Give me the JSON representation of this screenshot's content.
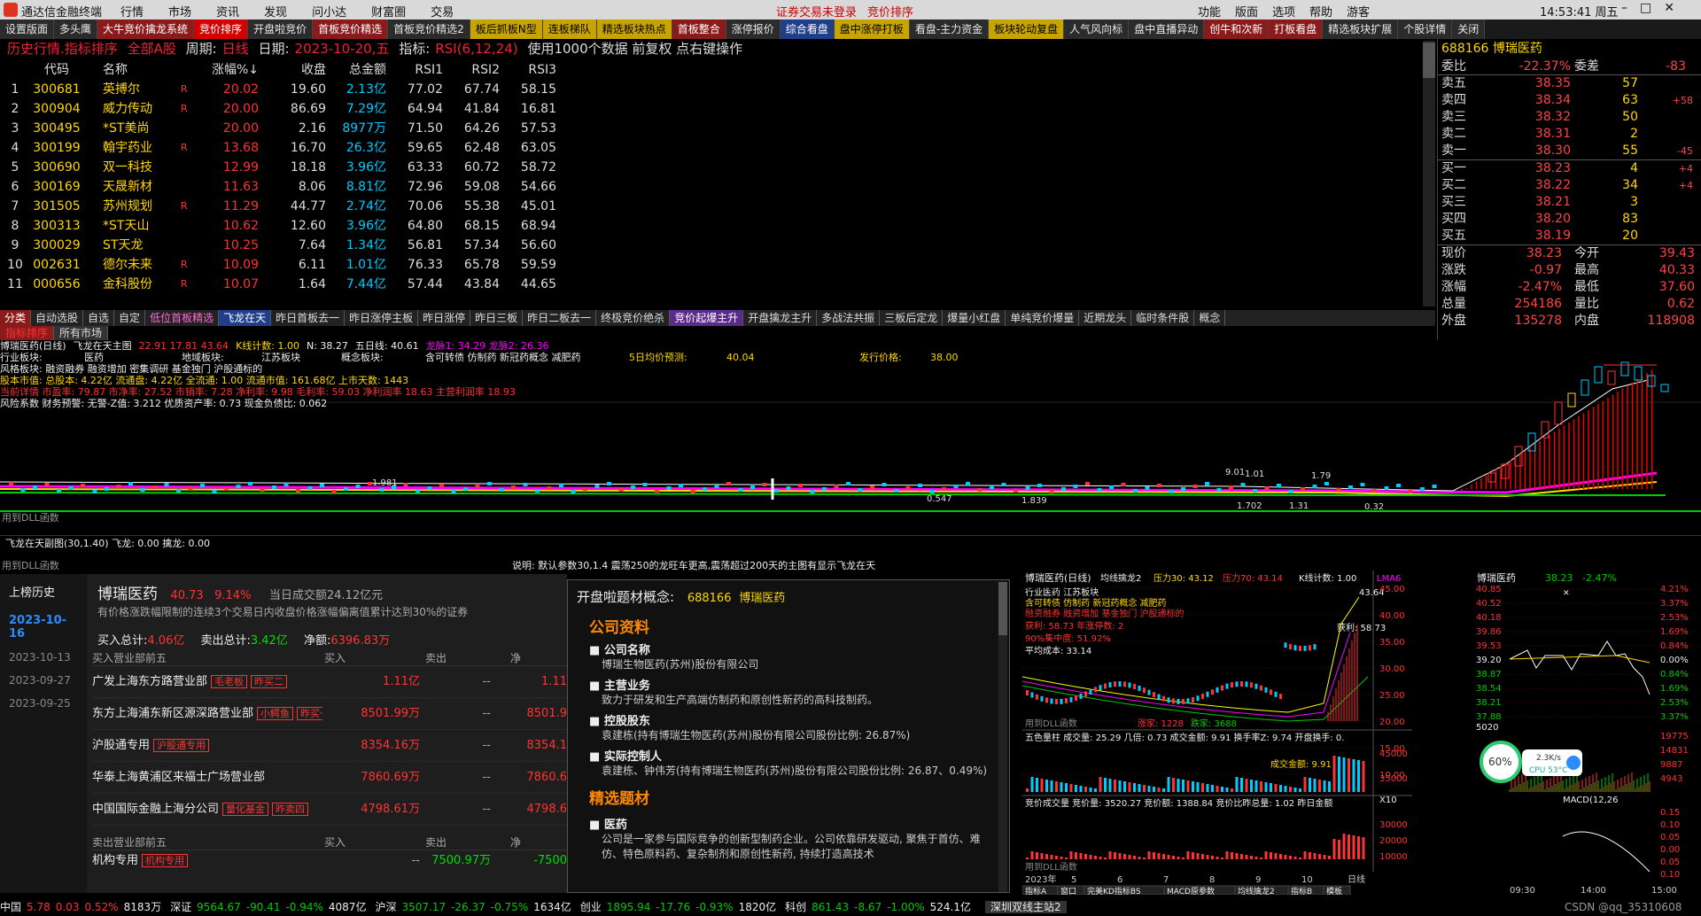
{
  "titlebar": {
    "app": "通达信金融终端",
    "menus": [
      "行情",
      "市场",
      "资讯",
      "发现",
      "问小达",
      "财富圈",
      "交易"
    ],
    "status": "证券交易未登录",
    "page": "竞价排序",
    "right": [
      "功能",
      "版面",
      "选项",
      "帮助",
      "游客"
    ],
    "time": "14:53:41 周五"
  },
  "tabs": [
    {
      "label": "设置版面",
      "cls": ""
    },
    {
      "label": "多头鹰",
      "cls": ""
    },
    {
      "label": "大牛竞价擒龙系统",
      "cls": "red"
    },
    {
      "label": "竞价排序",
      "cls": "act"
    },
    {
      "label": "开盘啦竞价",
      "cls": ""
    },
    {
      "label": "首板竞价精选",
      "cls": "red"
    },
    {
      "label": "首板竞价精选2",
      "cls": ""
    },
    {
      "label": "板后抓板N型",
      "cls": "yel"
    },
    {
      "label": "连板梯队",
      "cls": "yel"
    },
    {
      "label": "精选板块热点",
      "cls": "yel"
    },
    {
      "label": "首板整合",
      "cls": "red"
    },
    {
      "label": "涨停报价",
      "cls": ""
    },
    {
      "label": "综合看盘",
      "cls": "blu"
    },
    {
      "label": "盘中涨停打板",
      "cls": "yel"
    },
    {
      "label": "看盘-主力资金",
      "cls": ""
    },
    {
      "label": "板块轮动复盘",
      "cls": "yel"
    },
    {
      "label": "人气风向标",
      "cls": ""
    },
    {
      "label": "盘中直播异动",
      "cls": ""
    },
    {
      "label": "创牛和次新",
      "cls": "red"
    },
    {
      "label": "打板看盘",
      "cls": "red"
    },
    {
      "label": "精选板块扩展",
      "cls": ""
    },
    {
      "label": "个股详情",
      "cls": ""
    },
    {
      "label": "关闭",
      "cls": ""
    }
  ],
  "header": {
    "title": "历史行情.指标排序",
    "market": "全部A股",
    "period_label": "周期:",
    "period": "日线",
    "date_label": "日期:",
    "date": "2023-10-20,五",
    "indicator_label": "指标:",
    "indicator": "RSI(6,12,24)",
    "note": "使用1000个数据 前复权 点右键操作"
  },
  "table": {
    "headers": [
      "",
      "代码",
      "名称",
      "涨幅%↓",
      "收盘",
      "总金额",
      "RSI1",
      "RSI2",
      "RSI3"
    ],
    "rows": [
      {
        "n": "1",
        "code": "300681",
        "name": "英搏尔",
        "flag": "R",
        "chg": "20.02",
        "close": "19.60",
        "amt": "2.13亿",
        "r1": "77.02",
        "r2": "67.74",
        "r3": "58.15"
      },
      {
        "n": "2",
        "code": "300904",
        "name": "威力传动",
        "flag": "R",
        "chg": "20.00",
        "close": "86.69",
        "amt": "7.29亿",
        "r1": "64.94",
        "r2": "41.84",
        "r3": "16.81"
      },
      {
        "n": "3",
        "code": "300495",
        "name": "*ST美尚",
        "flag": "",
        "chg": "20.00",
        "close": "2.16",
        "amt": "8977万",
        "r1": "71.50",
        "r2": "64.26",
        "r3": "57.53"
      },
      {
        "n": "4",
        "code": "300199",
        "name": "翰宇药业",
        "flag": "R",
        "chg": "13.68",
        "close": "16.70",
        "amt": "26.3亿",
        "r1": "59.65",
        "r2": "62.48",
        "r3": "63.05"
      },
      {
        "n": "5",
        "code": "300690",
        "name": "双一科技",
        "flag": "",
        "chg": "12.99",
        "close": "18.18",
        "amt": "3.96亿",
        "r1": "63.33",
        "r2": "60.72",
        "r3": "58.72"
      },
      {
        "n": "6",
        "code": "300169",
        "name": "天晟新材",
        "flag": "",
        "chg": "11.63",
        "close": "8.06",
        "amt": "8.81亿",
        "r1": "72.96",
        "r2": "59.08",
        "r3": "54.66"
      },
      {
        "n": "7",
        "code": "301505",
        "name": "苏州规划",
        "flag": "R",
        "chg": "11.29",
        "close": "44.77",
        "amt": "2.74亿",
        "r1": "70.06",
        "r2": "55.38",
        "r3": "45.01"
      },
      {
        "n": "8",
        "code": "300313",
        "name": "*ST天山",
        "flag": "",
        "chg": "10.62",
        "close": "12.60",
        "amt": "3.96亿",
        "r1": "64.80",
        "r2": "68.15",
        "r3": "68.94"
      },
      {
        "n": "9",
        "code": "300029",
        "name": "ST天龙",
        "flag": "",
        "chg": "10.25",
        "close": "7.64",
        "amt": "1.34亿",
        "r1": "56.81",
        "r2": "57.34",
        "r3": "56.60"
      },
      {
        "n": "10",
        "code": "002631",
        "name": "德尔未来",
        "flag": "R",
        "chg": "10.09",
        "close": "6.11",
        "amt": "1.01亿",
        "r1": "76.33",
        "r2": "65.78",
        "r3": "59.59"
      },
      {
        "n": "11",
        "code": "000656",
        "name": "金科股份",
        "flag": "R",
        "chg": "10.07",
        "close": "1.64",
        "amt": "7.44亿",
        "r1": "57.44",
        "r2": "43.84",
        "r3": "44.65"
      }
    ]
  },
  "quote": {
    "code": "688166",
    "name": "博瑞医药",
    "wb_label": "委比",
    "wb": "-22.37%",
    "wc_label": "委差",
    "wc": "-83",
    "asks": [
      {
        "l": "卖五",
        "p": "38.35",
        "v": "57",
        "d": ""
      },
      {
        "l": "卖四",
        "p": "38.34",
        "v": "63",
        "d": "+58"
      },
      {
        "l": "卖三",
        "p": "38.32",
        "v": "50",
        "d": ""
      },
      {
        "l": "卖二",
        "p": "38.31",
        "v": "2",
        "d": ""
      },
      {
        "l": "卖一",
        "p": "38.30",
        "v": "55",
        "d": "-45"
      }
    ],
    "bids": [
      {
        "l": "买一",
        "p": "38.23",
        "v": "4",
        "d": "+4"
      },
      {
        "l": "买二",
        "p": "38.22",
        "v": "34",
        "d": "+4"
      },
      {
        "l": "买三",
        "p": "38.21",
        "v": "3",
        "d": ""
      },
      {
        "l": "买四",
        "p": "38.20",
        "v": "83",
        "d": ""
      },
      {
        "l": "买五",
        "p": "38.19",
        "v": "20",
        "d": ""
      }
    ],
    "stats": [
      {
        "l": "现价",
        "v": "38.23",
        "l2": "今开",
        "v2": "39.43"
      },
      {
        "l": "涨跌",
        "v": "-0.97",
        "l2": "最高",
        "v2": "40.33"
      },
      {
        "l": "涨幅",
        "v": "-2.47%",
        "l2": "最低",
        "v2": "37.60"
      },
      {
        "l": "总量",
        "v": "254186",
        "l2": "量比",
        "v2": "0.62"
      },
      {
        "l": "外盘",
        "v": "135278",
        "l2": "内盘",
        "v2": "118908"
      }
    ]
  },
  "tabs2": [
    "分类",
    "自动选股",
    "自选",
    "自定",
    "低位首板精选",
    "飞龙在天",
    "昨日首板去一",
    "昨日涨停主板",
    "昨日涨停",
    "昨日三板",
    "昨日二板去一",
    "终极竞价绝杀",
    "竞价起爆主升",
    "开盘擒龙主升",
    "多战法共振",
    "三板后定龙",
    "爆量小红盘",
    "单纯竞价爆量",
    "近期龙头",
    "临时条件股",
    "概念"
  ],
  "tabs3": [
    "指标排序",
    "所有市场"
  ],
  "chart": {
    "title": "博瑞医药(日线)",
    "ind": "飞龙在天主图",
    "vals": "22.91 17.81 43.64",
    "kcount": "K线计数: 1.00",
    "n": "N: 38.27",
    "wline": "五日线: 40.61",
    "dragon": "龙脉1: 34.29 龙脉2: 26.36",
    "l1": "行业板块:",
    "l1v": "医药",
    "l2": "地域板块:",
    "l2v": "江苏板块",
    "l3": "概念板块:",
    "l3v": "含可转债 仿制药 新冠药概念 减肥药",
    "l4": "风格板块:",
    "l4v": "融资融券 融资增加 密集调研 基金独门 沪股通标的",
    "fiveday": "5日均价预测:",
    "fiveday_v": "40.04",
    "fx": "发行价格:",
    "fx_v": "38.00",
    "cap": "股本市值: 总股本: 4.22亿 流通盘: 4.22亿 全流通: 1.00 流通市值: 161.68亿 上市天数: 1443",
    "fin": "当前详情 市盈率: 79.87 市净率: 27.52 市销率: 7.28 净利率: 9.98 毛利率: 59.03 净利润率 18.63 主营利润率 18.93",
    "risk": "风险系数 财务预警: 无警-Z值: 3.212 优质资产率: 0.73 现金负债比: 0.062",
    "dll": "用到DLL函数",
    "sub": "飞龙在天副图(30,1.40) 飞龙: 0.00 擒龙: 0.00",
    "note": "说明: 默认参数30,1.4 震荡250的龙旺车更高,震荡超过200天的主图有显示飞龙在天",
    "ann": [
      "1.981",
      "1.79",
      "1.01",
      "9.01",
      "0.547",
      "1.839",
      "1.702",
      "1.31",
      "0.32"
    ]
  },
  "lhb": {
    "side": [
      "上榜历史",
      "2023-10-16",
      "2023-10-13",
      "2023-09-27",
      "2023-09-25"
    ],
    "name": "博瑞医药",
    "price": "40.73",
    "pct": "9.14%",
    "amt": "当日成交额24.12亿元",
    "desc": "有价格涨跌幅限制的连续3个交易日内收盘价格涨幅偏离值累计达到30%的证券",
    "buy_total": "4.06亿",
    "sell_total": "3.42亿",
    "net": "6396.83万",
    "buy_label": "买入总计:",
    "sell_label": "卖出总计:",
    "net_label": "净额:",
    "col_h": [
      "买入营业部前五",
      "买入",
      "卖出",
      "净"
    ],
    "rows": [
      {
        "name": "广发上海东方路营业部",
        "tags": [
          "毛老板",
          "昨买二"
        ],
        "buy": "1.11亿",
        "sell": "--",
        "net": "1.11"
      },
      {
        "name": "东方上海浦东新区源深路营业部",
        "tags": [
          "小鳄鱼",
          "昨买一"
        ],
        "buy": "8501.99万",
        "sell": "--",
        "net": "8501.9"
      },
      {
        "name": "沪股通专用",
        "tags": [
          "沪股通专用"
        ],
        "buy": "8354.16万",
        "sell": "--",
        "net": "8354.1"
      },
      {
        "name": "华泰上海黄浦区来福士广场营业部",
        "tags": [],
        "buy": "7860.69万",
        "sell": "--",
        "net": "7860.6"
      },
      {
        "name": "中国国际金融上海分公司",
        "tags": [
          "量化基金",
          "昨卖四"
        ],
        "buy": "4798.61万",
        "sell": "--",
        "net": "4798.6"
      }
    ],
    "sell_h": [
      "卖出营业部前五",
      "买入",
      "卖出",
      "净"
    ],
    "sell_row": {
      "name": "机构专用",
      "tags": [
        "机构专用"
      ],
      "buy": "--",
      "sell": "7500.97万",
      "net": "-7500"
    }
  },
  "concept": {
    "title": "开盘啦题材概念:",
    "code": "688166",
    "name": "博瑞医药",
    "sec1": "公司资料",
    "items": [
      {
        "h": "公司名称",
        "t": "博瑞生物医药(苏州)股份有限公司"
      },
      {
        "h": "主营业务",
        "t": "致力于研发和生产高端仿制药和原创性新药的高科技制药。"
      },
      {
        "h": "控股股东",
        "t": "袁建栋(持有博瑞生物医药(苏州)股份有限公司股份比例: 26.87%)"
      },
      {
        "h": "实际控制人",
        "t": "袁建栋、钟伟芳(持有博瑞生物医药(苏州)股份有限公司股份比例: 26.87、0.49%)"
      }
    ],
    "sec2": "精选题材",
    "items2": [
      {
        "h": "医药",
        "t": "公司是一家参与国际竞争的创新型制药企业。公司依靠研发驱动, 聚焦于首仿、难仿、特色原料药、复杂制剂和原创性新药, 持续打造高技术"
      }
    ]
  },
  "kline": {
    "title": "博瑞医药(日线)",
    "ind": "均线擒龙2",
    "p30": "压力30: 43.12",
    "p70": "压力70: 43.14",
    "kc": "K线计数: 1.00",
    "ma": "LMA6",
    "l1": "行业医药 江苏板块",
    "l2": "含可转债 仿制药 新冠药概念 减肥药",
    "l3": "融资融券 融资增加 基金独门 沪股通标的",
    "hl": "获利: 58.73 年涨停数: 2",
    "p90": "90%集中度: 51.92%",
    "avgcost": "平均成本: 33.14",
    "yaxis": [
      "45.00",
      "40.00",
      "35.00",
      "30.00",
      "25.00",
      "20.00",
      "15.00",
      "10.00"
    ],
    "max": "43.64",
    "win": "获利: 58.73",
    "sub1": "五色量柱 成交量: 25.29 几倍: 0.73 成交金额: 9.91 换手率Z: 9.74 开盘换手: 0.",
    "sub1y": [
      "45000",
      "35000"
    ],
    "amtlbl": "成交金额: 9.91",
    "sub2": "竞价成交量 竞价量: 3520.27 竞价额: 1388.84 竞价比昨总量: 1.02 昨日金额",
    "sub2y": [
      "30000",
      "20000",
      "10000"
    ],
    "xlbl": [
      "2023年",
      "5",
      "6",
      "7",
      "8",
      "9",
      "10",
      "日线"
    ],
    "tabs": [
      "指标A",
      "窗口",
      "完美KD指标BS",
      "MACD原参数",
      "均线擒龙2",
      "指标B",
      "模板"
    ],
    "up": "涨家: 1228",
    "dn": "跌家: 3688",
    "x10": "X10",
    "dll": "用到DLL函数"
  },
  "intraday": {
    "name": "博瑞医药",
    "price": "38.23",
    "pct": "-2.47%",
    "yl": [
      "40.85",
      "40.52",
      "40.18",
      "39.86",
      "39.53",
      "39.20",
      "38.87",
      "38.54",
      "38.21",
      "37.88"
    ],
    "yr": [
      "4.21%",
      "3.37%",
      "2.53%",
      "1.69%",
      "0.84%",
      "0.00%",
      "0.84%",
      "1.69%",
      "2.53%",
      "3.37%"
    ],
    "vol": "5020",
    "volr": [
      "19775",
      "14831",
      "9887",
      "4943"
    ],
    "macd": "MACD(12,26",
    "mr": [
      "0.15",
      "0.10",
      "0.05",
      "0.00",
      "0.05",
      "0.10"
    ],
    "x": [
      "09:30",
      "14:00",
      "15:00"
    ],
    "cpu": "60%",
    "net": "2.3K/s",
    "temp": "CPU 53°C"
  },
  "status": {
    "items": [
      {
        "n": "中国",
        "v": "5.78",
        "c": "0.03",
        "p": "0.52%",
        "a": "8183万"
      },
      {
        "n": "深证",
        "v": "9564.67",
        "c": "-90.41",
        "p": "-0.94%",
        "a": "4087亿"
      },
      {
        "n": "沪深",
        "v": "3507.17",
        "c": "-26.37",
        "p": "-0.75%",
        "a": "1634亿"
      },
      {
        "n": "创业",
        "v": "1895.94",
        "c": "-17.76",
        "p": "-0.93%",
        "a": "1820亿"
      },
      {
        "n": "科创",
        "v": "861.43",
        "c": "-8.67",
        "p": "-1.00%",
        "a": "524.1亿"
      }
    ],
    "station": "深圳双线主站2",
    "watermark": "CSDN @qq_35310608"
  }
}
